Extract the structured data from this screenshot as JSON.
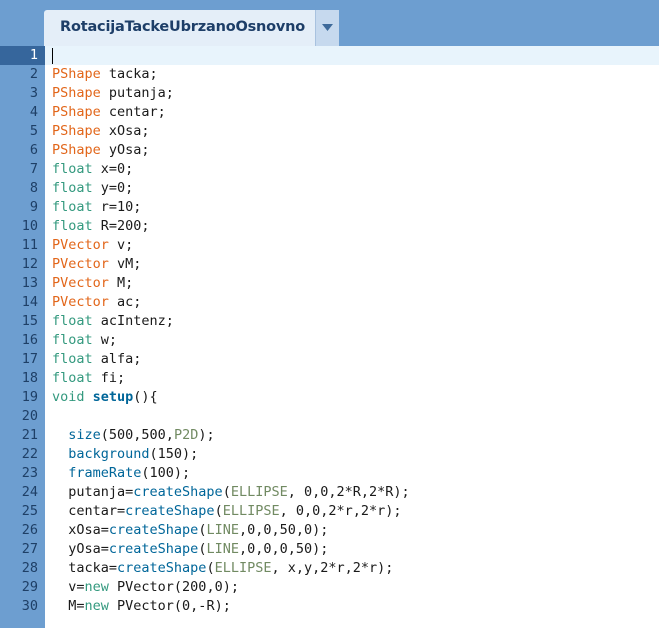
{
  "tab": {
    "title": "RotacijaTackeUbrzanoOsnovno",
    "menu_icon": "chevron-down-icon"
  },
  "editor": {
    "current_line": 1,
    "lines": [
      {
        "n": "1",
        "tokens": []
      },
      {
        "n": "2",
        "tokens": [
          [
            "type",
            "PShape"
          ],
          [
            "plain",
            " tacka;"
          ]
        ]
      },
      {
        "n": "3",
        "tokens": [
          [
            "type",
            "PShape"
          ],
          [
            "plain",
            " putanja;"
          ]
        ]
      },
      {
        "n": "4",
        "tokens": [
          [
            "type",
            "PShape"
          ],
          [
            "plain",
            " centar;"
          ]
        ]
      },
      {
        "n": "5",
        "tokens": [
          [
            "type",
            "PShape"
          ],
          [
            "plain",
            " xOsa;"
          ]
        ]
      },
      {
        "n": "6",
        "tokens": [
          [
            "type",
            "PShape"
          ],
          [
            "plain",
            " yOsa;"
          ]
        ]
      },
      {
        "n": "7",
        "tokens": [
          [
            "kw",
            "float"
          ],
          [
            "plain",
            " x=0;"
          ]
        ]
      },
      {
        "n": "8",
        "tokens": [
          [
            "kw",
            "float"
          ],
          [
            "plain",
            " y=0;"
          ]
        ]
      },
      {
        "n": "9",
        "tokens": [
          [
            "kw",
            "float"
          ],
          [
            "plain",
            " r=10;"
          ]
        ]
      },
      {
        "n": "10",
        "tokens": [
          [
            "kw",
            "float"
          ],
          [
            "plain",
            " R=200;"
          ]
        ]
      },
      {
        "n": "11",
        "tokens": [
          [
            "type",
            "PVector"
          ],
          [
            "plain",
            " v;"
          ]
        ]
      },
      {
        "n": "12",
        "tokens": [
          [
            "type",
            "PVector"
          ],
          [
            "plain",
            " vM;"
          ]
        ]
      },
      {
        "n": "13",
        "tokens": [
          [
            "type",
            "PVector"
          ],
          [
            "plain",
            " M;"
          ]
        ]
      },
      {
        "n": "14",
        "tokens": [
          [
            "type",
            "PVector"
          ],
          [
            "plain",
            " ac;"
          ]
        ]
      },
      {
        "n": "15",
        "tokens": [
          [
            "kw",
            "float"
          ],
          [
            "plain",
            " acIntenz;"
          ]
        ]
      },
      {
        "n": "16",
        "tokens": [
          [
            "kw",
            "float"
          ],
          [
            "plain",
            " w;"
          ]
        ]
      },
      {
        "n": "17",
        "tokens": [
          [
            "kw",
            "float"
          ],
          [
            "plain",
            " alfa;"
          ]
        ]
      },
      {
        "n": "18",
        "tokens": [
          [
            "kw",
            "float"
          ],
          [
            "plain",
            " fi;"
          ]
        ]
      },
      {
        "n": "19",
        "tokens": [
          [
            "kw",
            "void"
          ],
          [
            "plain",
            " "
          ],
          [
            "fnb",
            "setup"
          ],
          [
            "plain",
            "(){"
          ]
        ]
      },
      {
        "n": "20",
        "tokens": []
      },
      {
        "n": "21",
        "tokens": [
          [
            "plain",
            "  "
          ],
          [
            "fn",
            "size"
          ],
          [
            "plain",
            "(500,500,"
          ],
          [
            "const",
            "P2D"
          ],
          [
            "plain",
            ");"
          ]
        ]
      },
      {
        "n": "22",
        "tokens": [
          [
            "plain",
            "  "
          ],
          [
            "fn",
            "background"
          ],
          [
            "plain",
            "(150);"
          ]
        ]
      },
      {
        "n": "23",
        "tokens": [
          [
            "plain",
            "  "
          ],
          [
            "fn",
            "frameRate"
          ],
          [
            "plain",
            "(100);"
          ]
        ]
      },
      {
        "n": "24",
        "tokens": [
          [
            "plain",
            "  putanja="
          ],
          [
            "fn",
            "createShape"
          ],
          [
            "plain",
            "("
          ],
          [
            "const",
            "ELLIPSE"
          ],
          [
            "plain",
            ", 0,0,2*R,2*R);"
          ]
        ]
      },
      {
        "n": "25",
        "tokens": [
          [
            "plain",
            "  centar="
          ],
          [
            "fn",
            "createShape"
          ],
          [
            "plain",
            "("
          ],
          [
            "const",
            "ELLIPSE"
          ],
          [
            "plain",
            ", 0,0,2*r,2*r);"
          ]
        ]
      },
      {
        "n": "26",
        "tokens": [
          [
            "plain",
            "  xOsa="
          ],
          [
            "fn",
            "createShape"
          ],
          [
            "plain",
            "("
          ],
          [
            "const",
            "LINE"
          ],
          [
            "plain",
            ",0,0,50,0);"
          ]
        ]
      },
      {
        "n": "27",
        "tokens": [
          [
            "plain",
            "  yOsa="
          ],
          [
            "fn",
            "createShape"
          ],
          [
            "plain",
            "("
          ],
          [
            "const",
            "LINE"
          ],
          [
            "plain",
            ",0,0,0,50);"
          ]
        ]
      },
      {
        "n": "28",
        "tokens": [
          [
            "plain",
            "  tacka="
          ],
          [
            "fn",
            "createShape"
          ],
          [
            "plain",
            "("
          ],
          [
            "const",
            "ELLIPSE"
          ],
          [
            "plain",
            ", x,y,2*r,2*r);"
          ]
        ]
      },
      {
        "n": "29",
        "tokens": [
          [
            "plain",
            "  v="
          ],
          [
            "kw",
            "new"
          ],
          [
            "plain",
            " PVector(200,0);"
          ]
        ]
      },
      {
        "n": "30",
        "tokens": [
          [
            "plain",
            "  M="
          ],
          [
            "kw",
            "new"
          ],
          [
            "plain",
            " PVector(0,-R);"
          ]
        ]
      }
    ]
  }
}
